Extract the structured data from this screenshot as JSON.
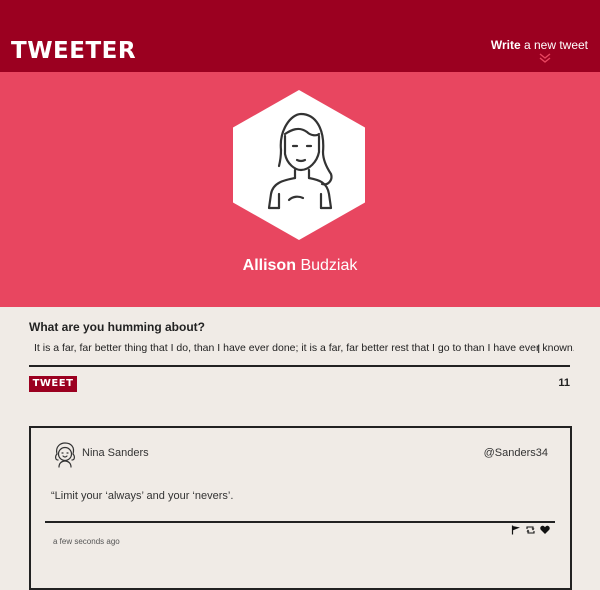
{
  "header": {
    "logo": "TWEETER",
    "write_bold": "Write",
    "write_rest": " a new tweet"
  },
  "profile": {
    "first_name": "Allison",
    "last_name": "Budziak"
  },
  "compose": {
    "prompt": "What are you humming about?",
    "value": "It is a far, far better thing that I do, than I have ever done; it is a far, far better rest that I go to than I have ever known.",
    "button_label": "TWEET",
    "char_count": "11"
  },
  "tweets": [
    {
      "author": "Nina Sanders",
      "handle": "@Sanders34",
      "text": "“Limit your ‘always’ and your ‘nevers’.",
      "timestamp": "a few seconds ago"
    }
  ],
  "colors": {
    "header_bg": "#9b0020",
    "hero_bg": "#e84660",
    "page_bg": "#f0ebe6",
    "accent": "#9b0020"
  },
  "icons": [
    "chevron-down-icon",
    "flag-icon",
    "retweet-icon",
    "heart-icon"
  ]
}
